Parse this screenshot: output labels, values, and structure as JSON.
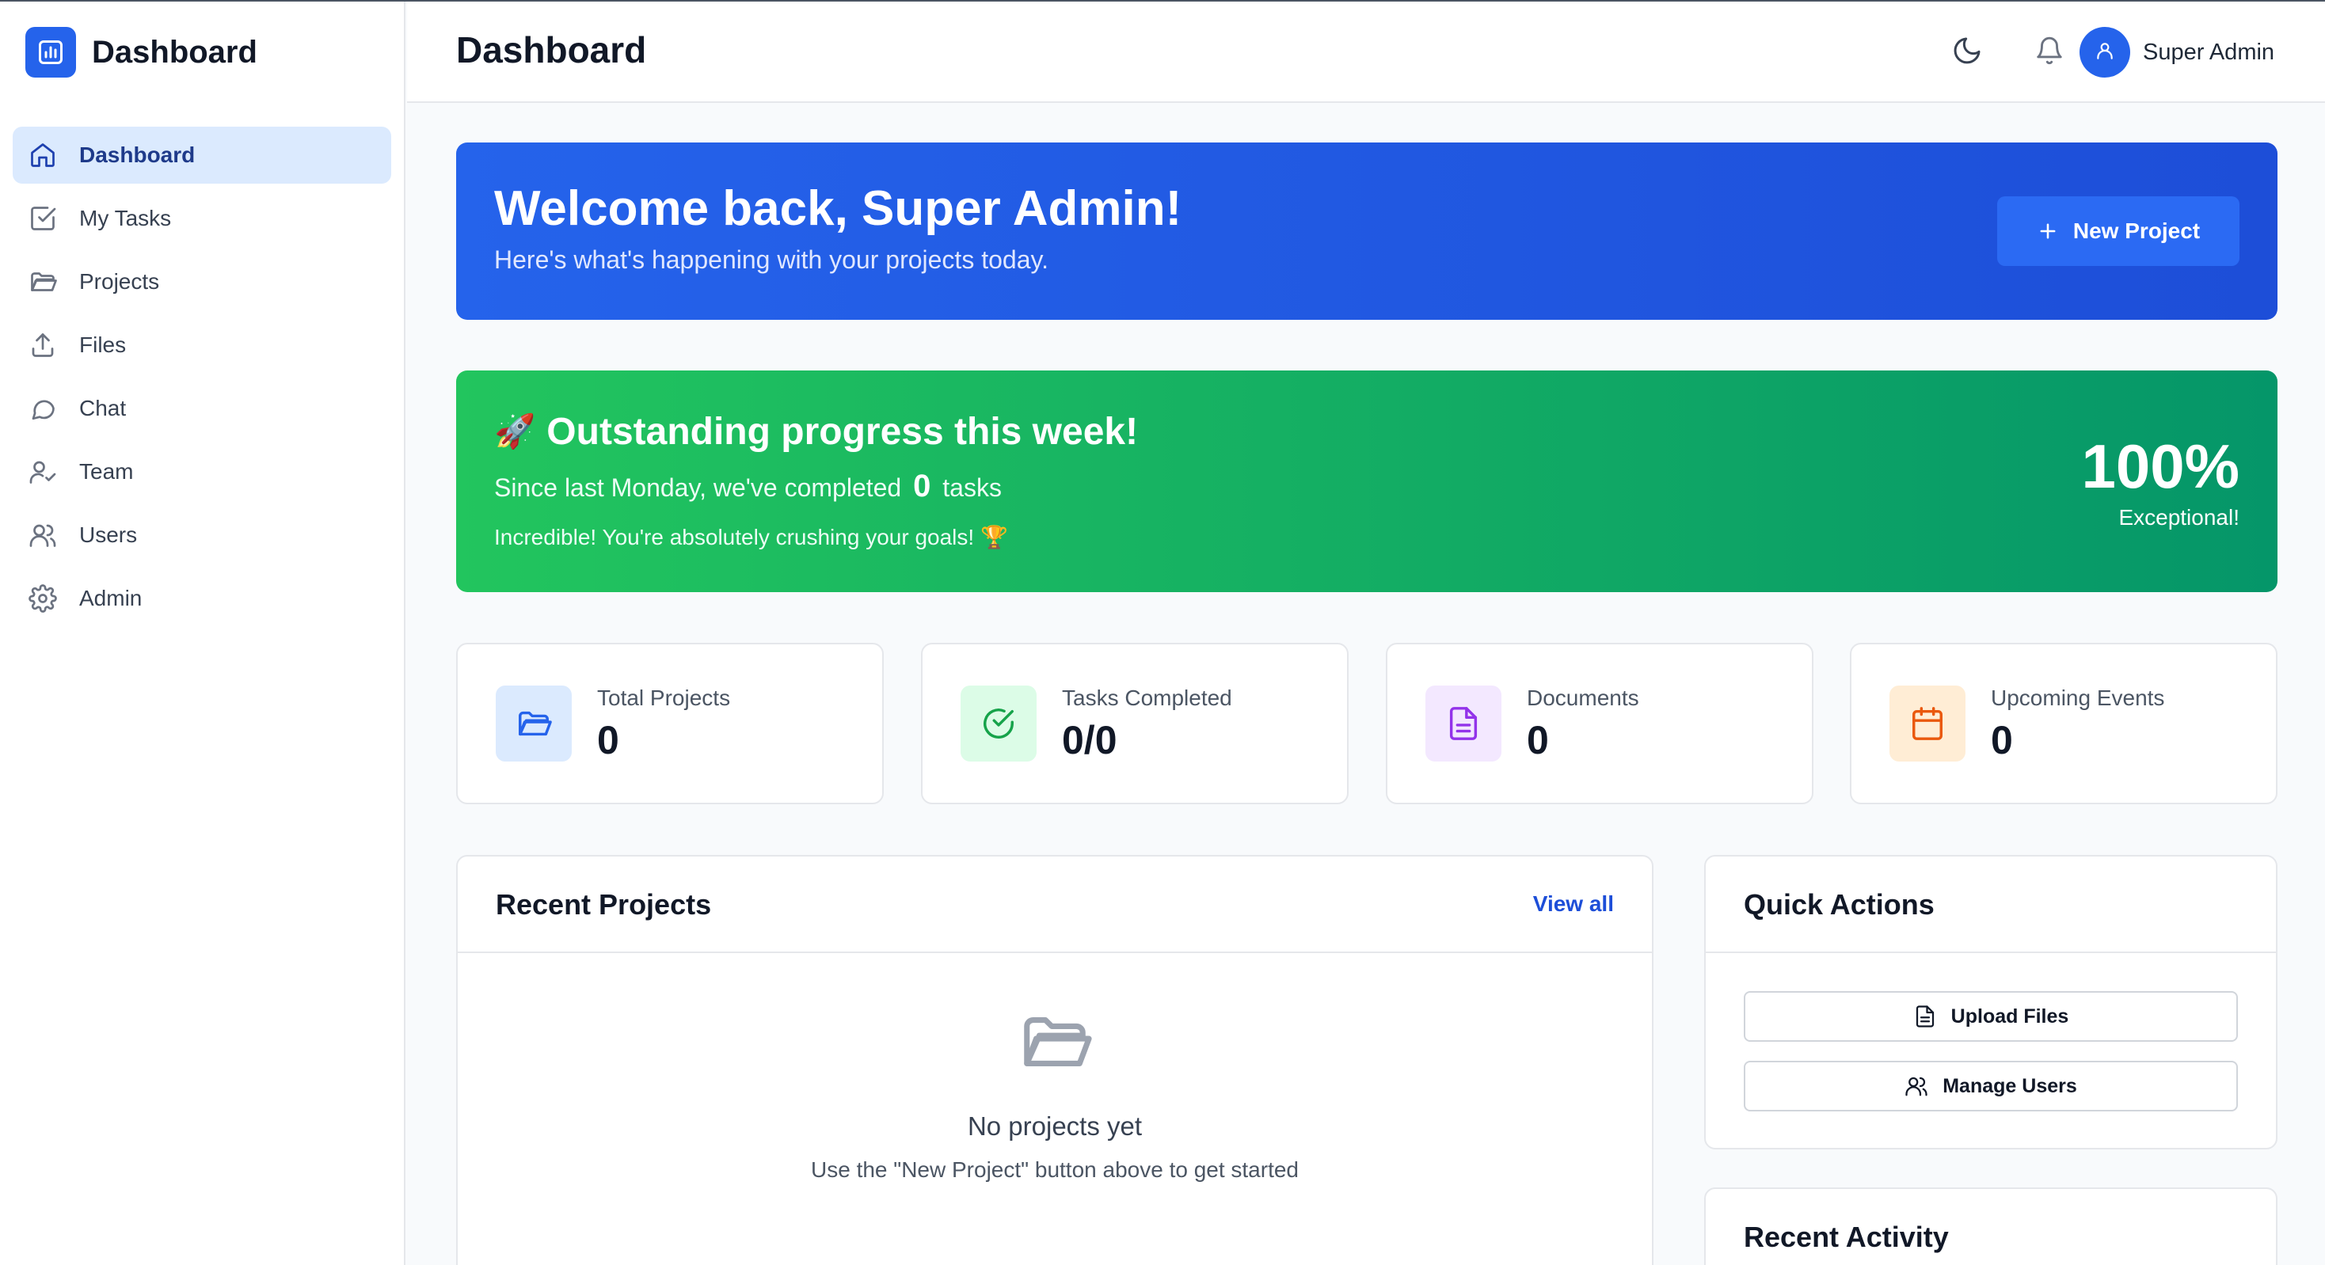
{
  "brand": {
    "title": "Dashboard",
    "logo_icon": "bar-chart-icon",
    "accent": "#2563eb"
  },
  "sidebar": {
    "items": [
      {
        "label": "Dashboard",
        "icon": "home-icon",
        "active": true
      },
      {
        "label": "My Tasks",
        "icon": "check-square-icon"
      },
      {
        "label": "Projects",
        "icon": "folder-open-icon"
      },
      {
        "label": "Files",
        "icon": "upload-icon"
      },
      {
        "label": "Chat",
        "icon": "chat-bubble-icon"
      },
      {
        "label": "Team",
        "icon": "user-check-icon"
      },
      {
        "label": "Users",
        "icon": "users-icon"
      },
      {
        "label": "Admin",
        "icon": "gear-icon"
      }
    ]
  },
  "header": {
    "title": "Dashboard",
    "theme_icon": "moon-icon",
    "notification_icon": "bell-icon",
    "user_name": "Super Admin",
    "avatar_icon": "user-icon"
  },
  "welcome": {
    "title": "Welcome back, Super Admin!",
    "subtitle": "Here's what's happening with your projects today.",
    "button_label": "New Project"
  },
  "progress": {
    "emoji": "🚀",
    "title": "Outstanding progress this week!",
    "sub_prefix": "Since last Monday, we've completed",
    "count": "0",
    "sub_suffix": "tasks",
    "note": "Incredible! You're absolutely crushing your goals! 🏆",
    "percent": "100%",
    "rating": "Exceptional!"
  },
  "stats": [
    {
      "label": "Total Projects",
      "value": "0",
      "icon": "folder-open-icon",
      "color": "#2563eb",
      "bg": "#dbeafe"
    },
    {
      "label": "Tasks Completed",
      "value": "0/0",
      "icon": "check-circle-icon",
      "color": "#16a34a",
      "bg": "#dcfce7"
    },
    {
      "label": "Documents",
      "value": "0",
      "icon": "document-icon",
      "color": "#9333ea",
      "bg": "#f3e8ff"
    },
    {
      "label": "Upcoming Events",
      "value": "0",
      "icon": "calendar-icon",
      "color": "#ea580c",
      "bg": "#ffedd5"
    }
  ],
  "recent_projects": {
    "title": "Recent Projects",
    "view_all": "View all",
    "empty_title": "No projects yet",
    "empty_subtitle": "Use the \"New Project\" button above to get started"
  },
  "quick_actions": {
    "title": "Quick Actions",
    "buttons": [
      {
        "label": "Upload Files",
        "icon": "document-icon"
      },
      {
        "label": "Manage Users",
        "icon": "users-icon"
      }
    ]
  },
  "recent_activity": {
    "title": "Recent Activity"
  }
}
